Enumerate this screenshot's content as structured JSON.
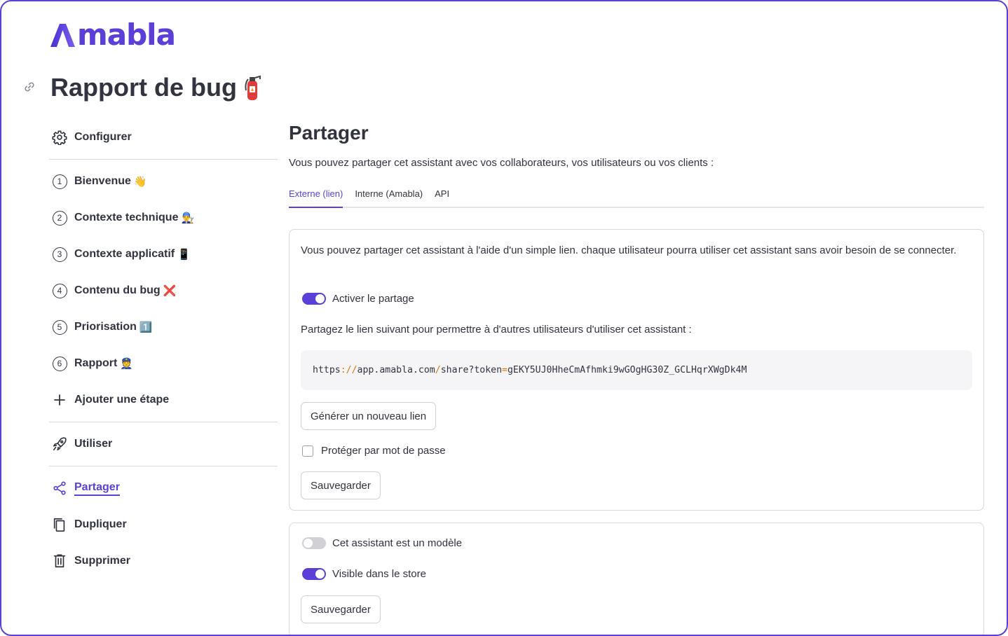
{
  "brand": {
    "name": "mabla",
    "color": "#5b3fd6"
  },
  "page": {
    "title": "Rapport de bug",
    "title_icon": "fire-extinguisher-icon"
  },
  "sidebar": {
    "configure": "Configurer",
    "steps": [
      {
        "num": "1",
        "label": "Bienvenue",
        "emoji": "👋"
      },
      {
        "num": "2",
        "label": "Contexte technique",
        "emoji": "👨‍🔧"
      },
      {
        "num": "3",
        "label": "Contexte applicatif",
        "emoji": "📱"
      },
      {
        "num": "4",
        "label": "Contenu du bug",
        "emoji": "❌"
      },
      {
        "num": "5",
        "label": "Priorisation",
        "emoji": "1️⃣"
      },
      {
        "num": "6",
        "label": "Rapport",
        "emoji": "👮"
      }
    ],
    "add_step": "Ajouter une étape",
    "use": "Utiliser",
    "share": "Partager",
    "duplicate": "Dupliquer",
    "delete": "Supprimer"
  },
  "main": {
    "heading": "Partager",
    "intro": "Vous pouvez partager cet assistant avec vos collaborateurs, vos utilisateurs ou vos clients :",
    "tabs": [
      "Externe (lien)",
      "Interne (Amabla)",
      "API"
    ],
    "active_tab": "Externe (lien)",
    "card1": {
      "description": "Vous pouvez partager cet assistant à l'aide d'un simple lien. chaque utilisateur pourra utiliser cet assistant sans avoir besoin de se connecter.",
      "toggle_label": "Activer le partage",
      "toggle_on": true,
      "share_text": "Partagez le lien suivant pour permettre à d'autres utilisateurs d'utiliser cet assistant :",
      "link": {
        "p1": "https",
        "p2": "://",
        "p3": "app",
        "p4": ".",
        "p5": "amabla",
        "p6": ".",
        "p7": "com",
        "p8": "/",
        "p9": "share?token",
        "p10": "=",
        "p11": "gEKY5UJ0HheCmAfhmki9wGOgHG30Z_GCLHqrXWgDk4M"
      },
      "generate_button": "Générer un nouveau lien",
      "password_label": "Protéger par mot de passe",
      "password_checked": false,
      "save_button": "Sauvegarder"
    },
    "card2": {
      "template_label": "Cet assistant est un modèle",
      "template_on": false,
      "store_label": "Visible dans le store",
      "store_on": true,
      "save_button": "Sauvegarder"
    }
  }
}
